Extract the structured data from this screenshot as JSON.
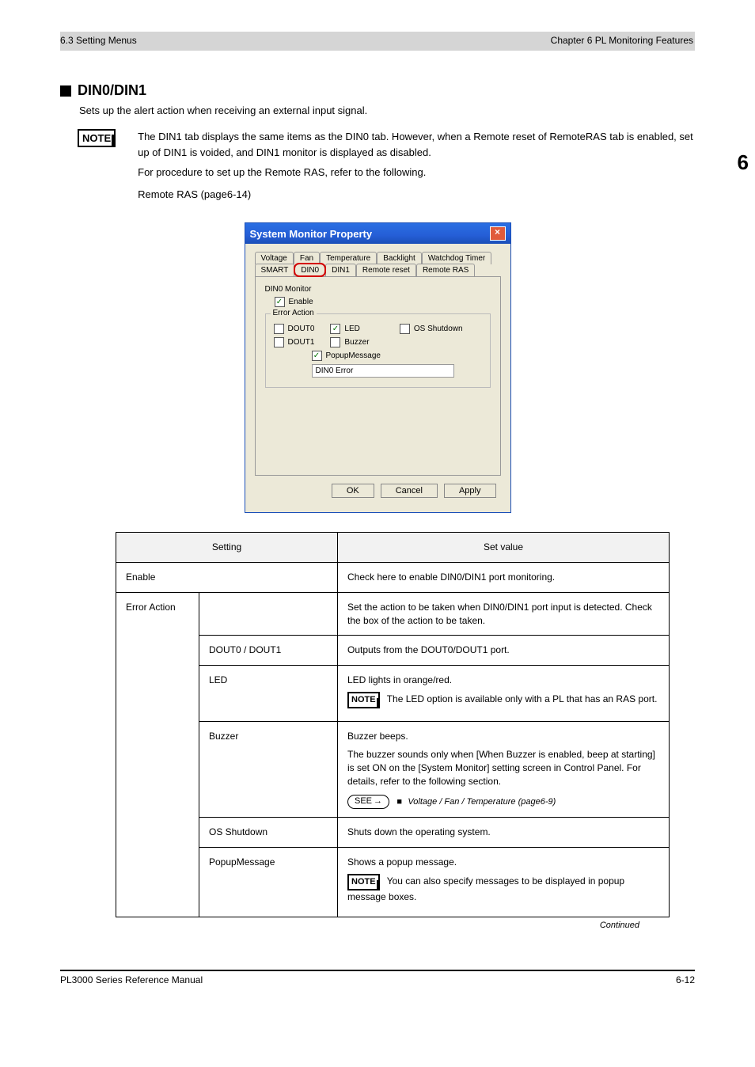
{
  "running_head_left": "6.3 Setting Menus",
  "chapter_label": "Chapter 6 PL Monitoring Features",
  "sidebar_index": "6",
  "section": {
    "bullet_title": "DIN0/DIN1",
    "intro": "Sets up the alert action when receiving an external input signal.",
    "note_paragraph": "The DIN1 tab displays the same items as the DIN0 tab. However, when a Remote reset of RemoteRAS tab is enabled, set up of DIN1 is voided, and DIN1 monitor is displayed as disabled.",
    "see_sentence": "For procedure to set up the Remote RAS, refer to the following.",
    "see_ref": "Remote RAS (page6-14)"
  },
  "window": {
    "title": "System Monitor Property",
    "tabs_row1": [
      "Voltage",
      "Fan",
      "Temperature",
      "Backlight",
      "Watchdog Timer"
    ],
    "tabs_row2": [
      "SMART",
      "DIN0",
      "DIN1",
      "Remote reset",
      "Remote RAS"
    ],
    "monitor_label": "DIN0 Monitor",
    "enable_label": "Enable",
    "fieldset_legend": "Error Action",
    "checkboxes": {
      "dout0": "DOUT0",
      "dout1": "DOUT1",
      "led": "LED",
      "buzzer": "Buzzer",
      "osshutdown": "OS Shutdown",
      "popup": "PopupMessage"
    },
    "text_input_value": "DIN0 Error",
    "buttons": {
      "ok": "OK",
      "cancel": "Cancel",
      "apply": "Apply"
    }
  },
  "table": {
    "headers": [
      "Setting",
      "Set value"
    ],
    "r1_c1": "Enable",
    "r1_c2": "Check here to enable DIN0/DIN1 port monitoring.",
    "error_action_label": "Error Action",
    "r2_c2": "Set the action to be taken when DIN0/DIN1 port input is detected. Check the box of the action to be taken.",
    "r_dout": "DOUT0 / DOUT1",
    "r_dout_v": "Outputs from the DOUT0/DOUT1 port.",
    "r_led": "LED",
    "r_led_v": "LED lights in orange/red.",
    "r_led_note": "The LED option is available only with a PL that has an RAS port.",
    "r_buzzer": "Buzzer",
    "r_buzzer_v1": "Buzzer beeps.",
    "r_buzzer_v2": "The buzzer sounds only when [When Buzzer is enabled, beep at starting] is set ON on the [System Monitor] setting screen in Control Panel. For details, refer to the following section.",
    "r_buzzer_see": "Voltage / Fan / Temperature (page6-9)",
    "r_os": "OS Shutdown",
    "r_os_v": "Shuts down the operating system.",
    "r_popup": "PopupMessage",
    "r_popup_v": "Shows a popup message.",
    "r_popup_note": "You can also specify messages to be displayed in popup message boxes."
  },
  "notes": {
    "badge": "NOTE",
    "see_label": "SEE"
  },
  "continued": "Continued",
  "footer_left": "PL3000 Series Reference Manual",
  "footer_right": "6-12"
}
